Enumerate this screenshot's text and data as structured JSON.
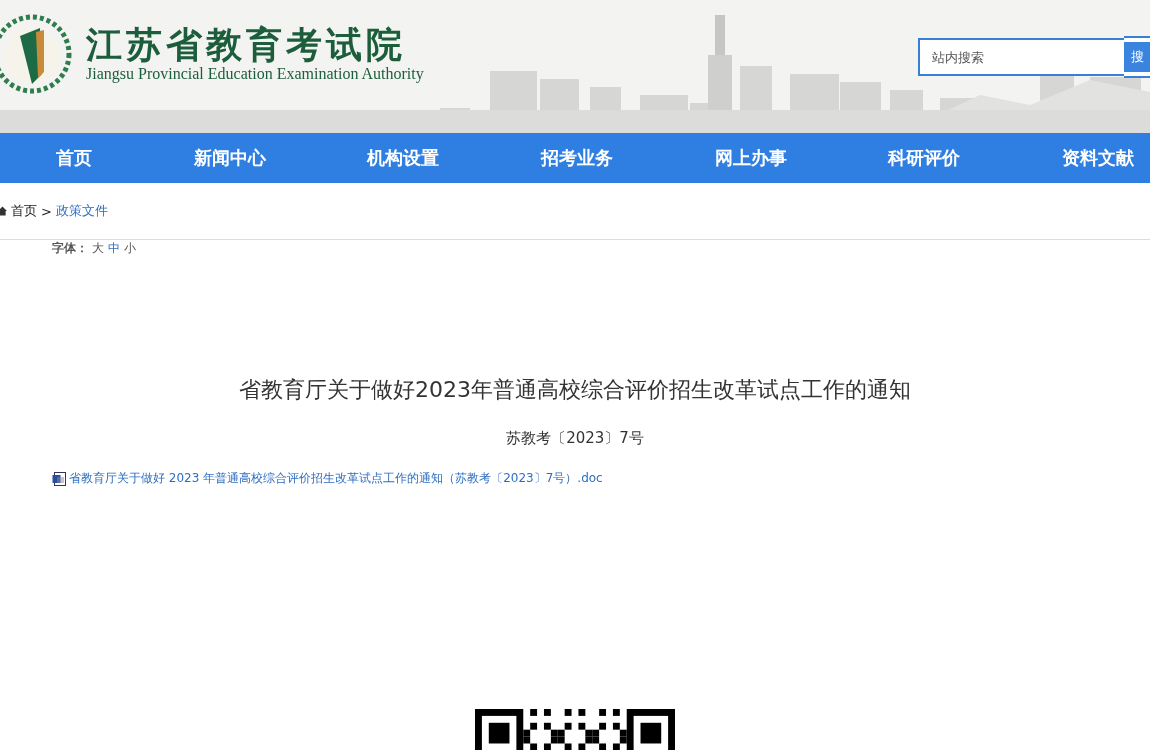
{
  "header": {
    "title": "江苏省教育考试院",
    "subtitle": "Jiangsu Provincial Education Examination Authority",
    "search": {
      "placeholder": "站内搜索",
      "button": "搜"
    }
  },
  "nav": [
    {
      "label": "首页"
    },
    {
      "label": "新闻中心"
    },
    {
      "label": "机构设置"
    },
    {
      "label": "招考业务"
    },
    {
      "label": "网上办事"
    },
    {
      "label": "科研评价"
    },
    {
      "label": "资料文献"
    }
  ],
  "breadcrumb": [
    {
      "label": "首页",
      "kind": "home"
    },
    {
      "label": "政策文件",
      "kind": "link"
    }
  ],
  "breadcrumb_separator": ">",
  "font_size": {
    "label": "字体：",
    "options": [
      {
        "label": "大",
        "selected": false
      },
      {
        "label": "中",
        "selected": true
      },
      {
        "label": "小",
        "selected": false
      }
    ]
  },
  "article": {
    "title": "省教育厅关于做好2023年普通高校综合评价招生改革试点工作的通知",
    "doc_number": "苏教考〔2023〕7号",
    "attachment": "省教育厅关于做好 2023 年普通高校综合评价招生改革试点工作的通知（苏教考〔2023〕7号）.doc"
  }
}
